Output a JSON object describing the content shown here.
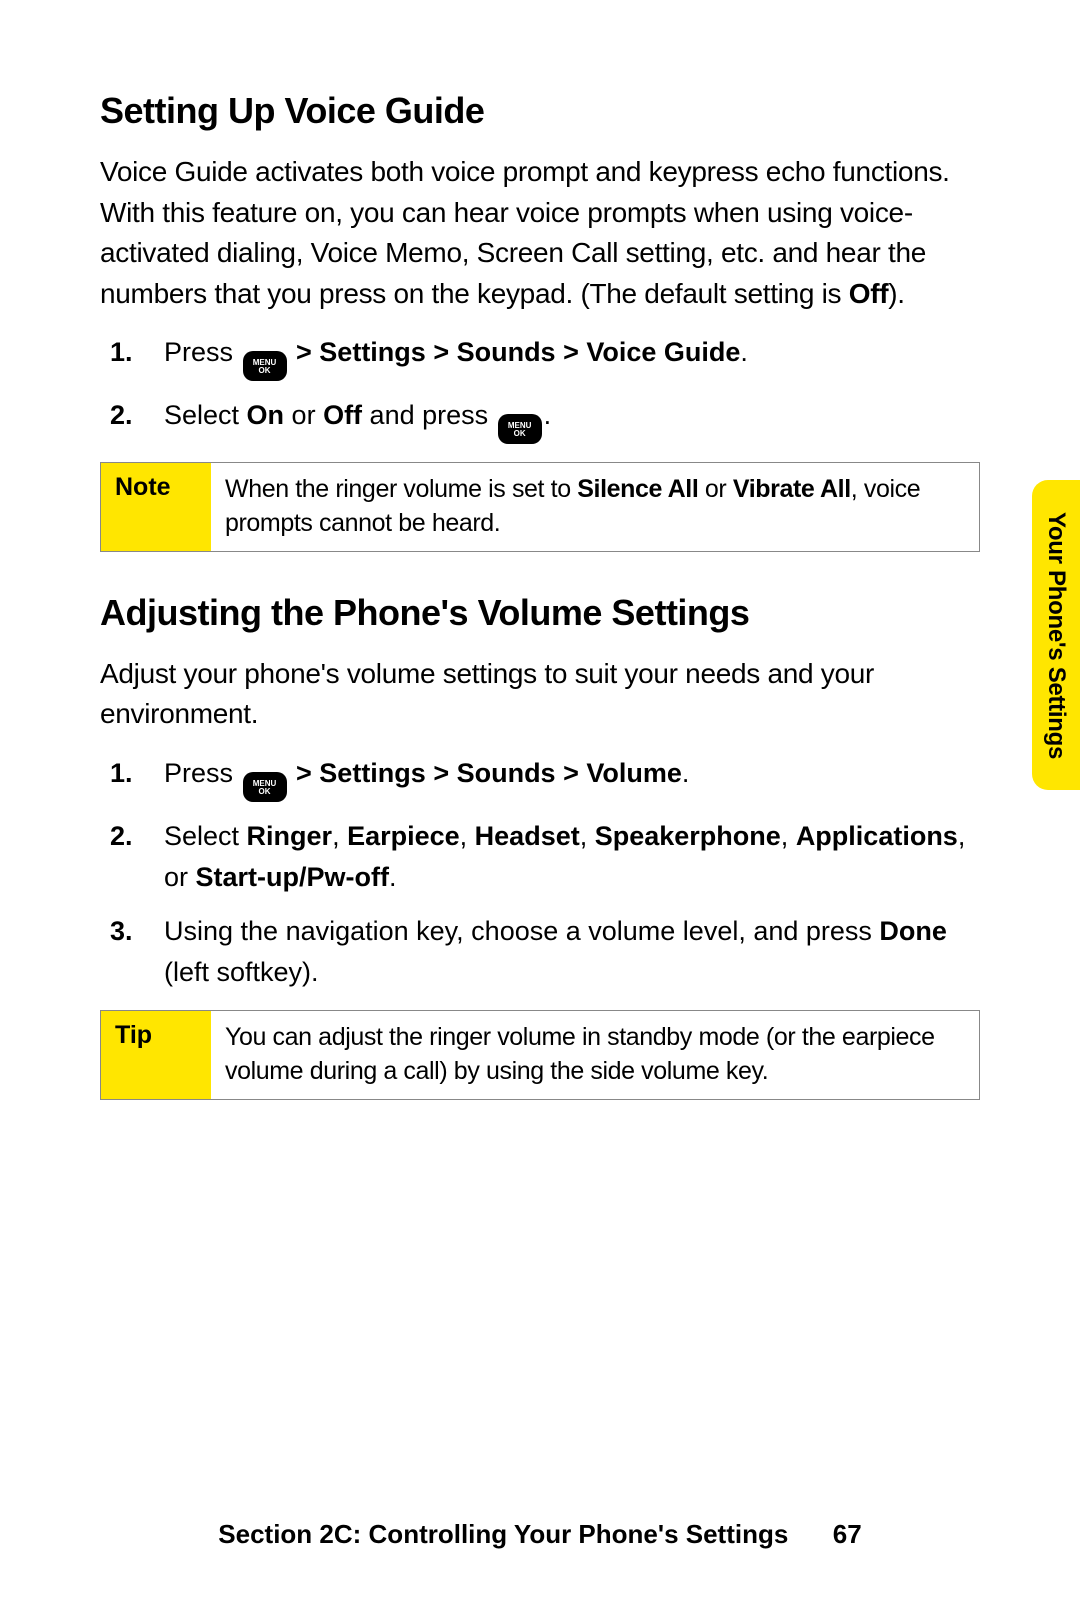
{
  "section1": {
    "heading": "Setting Up Voice Guide",
    "intro_parts": {
      "p1": "Voice Guide activates both voice prompt and keypress echo functions. With this feature on, you can hear voice prompts when using voice-activated dialing, Voice Memo, Screen Call setting, etc. and hear the numbers that you press on the keypad. (The default setting is ",
      "off": "Off",
      "p2": ")."
    },
    "steps": {
      "s1": {
        "num": "1.",
        "a": "Press ",
        "b": " > Settings > Sounds > Voice Guide",
        "c": "."
      },
      "s2": {
        "num": "2.",
        "a": "Select ",
        "on": "On",
        "mid": " or ",
        "off": "Off",
        "b": " and press ",
        "c": "."
      }
    },
    "note": {
      "label": "Note",
      "a": "When the ringer volume is set to ",
      "s1": "Silence All",
      "mid": " or ",
      "s2": "Vibrate All",
      "b": ", voice prompts cannot be heard."
    }
  },
  "section2": {
    "heading": "Adjusting the Phone's Volume Settings",
    "intro": "Adjust your phone's volume settings to suit your needs and your environment.",
    "steps": {
      "s1": {
        "num": "1.",
        "a": "Press ",
        "b": " > Settings > Sounds > Volume",
        "c": "."
      },
      "s2": {
        "num": "2.",
        "a": "Select ",
        "r": "Ringer",
        "c1": ", ",
        "e": "Earpiece",
        "c2": ", ",
        "h": "Headset",
        "c3": ", ",
        "sp": "Speakerphone",
        "c4": ", ",
        "ap": "Applications",
        "c5": ", or ",
        "st": "Start-up/Pw-off",
        "c6": "."
      },
      "s3": {
        "num": "3.",
        "a": "Using the navigation key, choose a volume level, and press ",
        "done": "Done",
        "b": " (left softkey)."
      }
    },
    "tip": {
      "label": "Tip",
      "text": "You can adjust the ringer volume in standby mode (or the earpiece volume during a call) by using the side volume key."
    }
  },
  "icon": {
    "menu": "MENU",
    "ok": "OK"
  },
  "sidetab": "Your Phone's Settings",
  "footer": {
    "text": "Section 2C: Controlling Your Phone's Settings",
    "page": "67"
  }
}
